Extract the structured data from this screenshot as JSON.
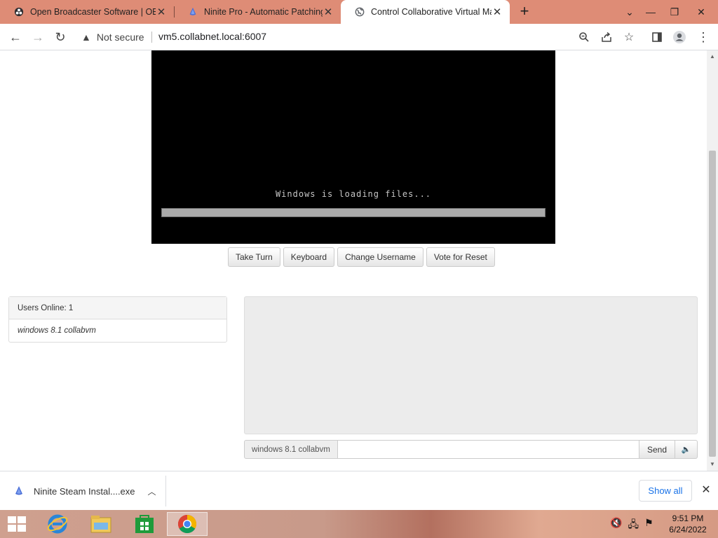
{
  "browser": {
    "tabs": [
      {
        "title": "Open Broadcaster Software | OBS",
        "favicon": "obs-icon"
      },
      {
        "title": "Ninite Pro - Automatic Patching and",
        "favicon": "ninite-icon"
      },
      {
        "title": "Control Collaborative Virtual Machi",
        "favicon": "globe-icon",
        "active": true
      }
    ],
    "security_label": "Not secure",
    "url": "vm5.collabnet.local:6007"
  },
  "vm": {
    "loading_text": "Windows is loading files...",
    "progress": 1.0,
    "buttons": [
      "Take Turn",
      "Keyboard",
      "Change Username",
      "Vote for Reset"
    ]
  },
  "users": {
    "header": "Users Online: 1",
    "list": [
      "windows 8.1 collabvm"
    ]
  },
  "chat": {
    "username": "windows 8.1 collabvm",
    "input_value": "",
    "send_label": "Send"
  },
  "downloads": {
    "filename": "Ninite Steam Instal....exe",
    "show_all_label": "Show all"
  },
  "taskbar": {
    "time": "9:51 PM",
    "date": "6/24/2022"
  }
}
